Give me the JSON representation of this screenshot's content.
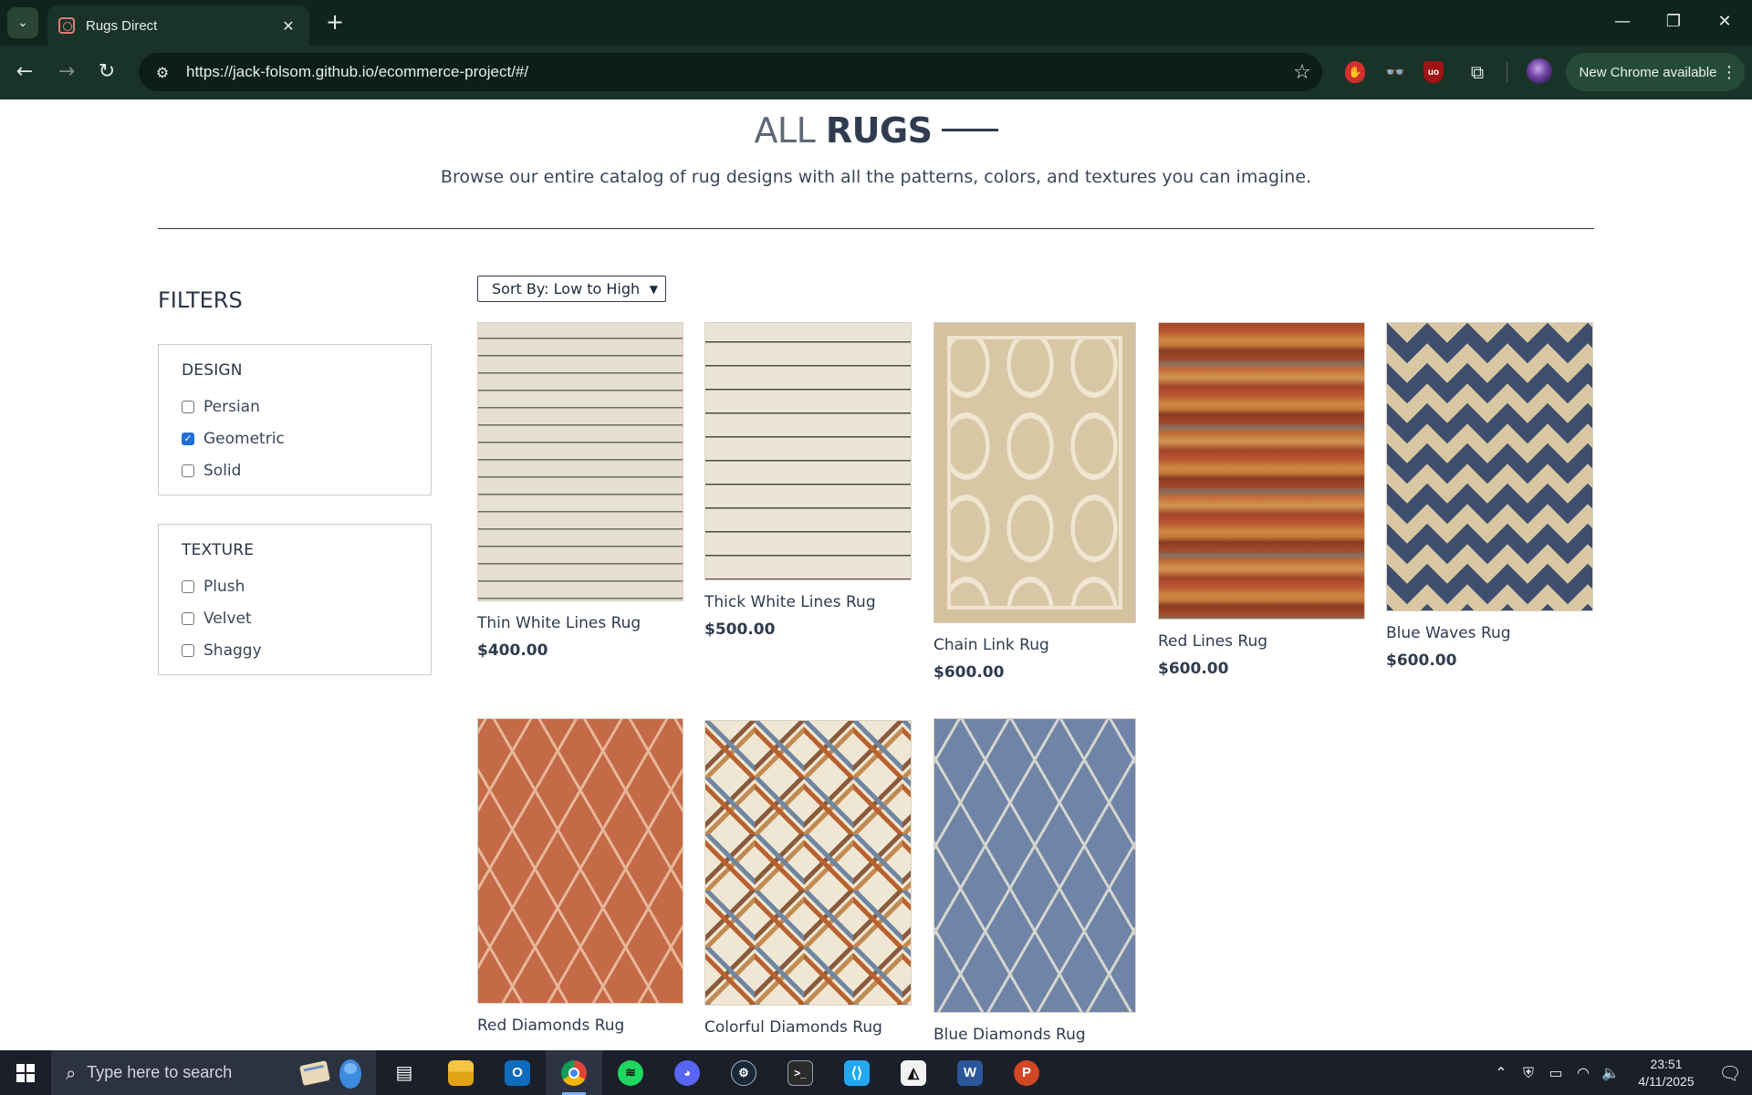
{
  "browser": {
    "tab_title": "Rugs Direct",
    "url": "https://jack-folsom.github.io/ecommerce-project/#/",
    "update_label": "New Chrome available"
  },
  "page": {
    "heading_light": "ALL",
    "heading_bold": "RUGS",
    "subheading": "Browse our entire catalog of rug designs with all the patterns, colors, and textures you can imagine."
  },
  "filters": {
    "title": "FILTERS",
    "design": {
      "heading": "DESIGN",
      "options": [
        {
          "label": "Persian",
          "checked": false
        },
        {
          "label": "Geometric",
          "checked": true
        },
        {
          "label": "Solid",
          "checked": false
        }
      ]
    },
    "texture": {
      "heading": "TEXTURE",
      "options": [
        {
          "label": "Plush",
          "checked": false
        },
        {
          "label": "Velvet",
          "checked": false
        },
        {
          "label": "Shaggy",
          "checked": false
        }
      ]
    }
  },
  "sort": {
    "selected": "Sort By: Low to High"
  },
  "products": [
    {
      "name": "Thin White Lines Rug",
      "price": "$400.00"
    },
    {
      "name": "Thick White Lines Rug",
      "price": "$500.00"
    },
    {
      "name": "Chain Link Rug",
      "price": "$600.00"
    },
    {
      "name": "Red Lines Rug",
      "price": "$600.00"
    },
    {
      "name": "Blue Waves Rug",
      "price": "$600.00"
    },
    {
      "name": "Red Diamonds Rug"
    },
    {
      "name": "Colorful Diamonds Rug"
    },
    {
      "name": "Blue Diamonds Rug"
    }
  ],
  "taskbar": {
    "search_placeholder": "Type here to search",
    "time": "23:51",
    "date": "4/11/2025"
  }
}
